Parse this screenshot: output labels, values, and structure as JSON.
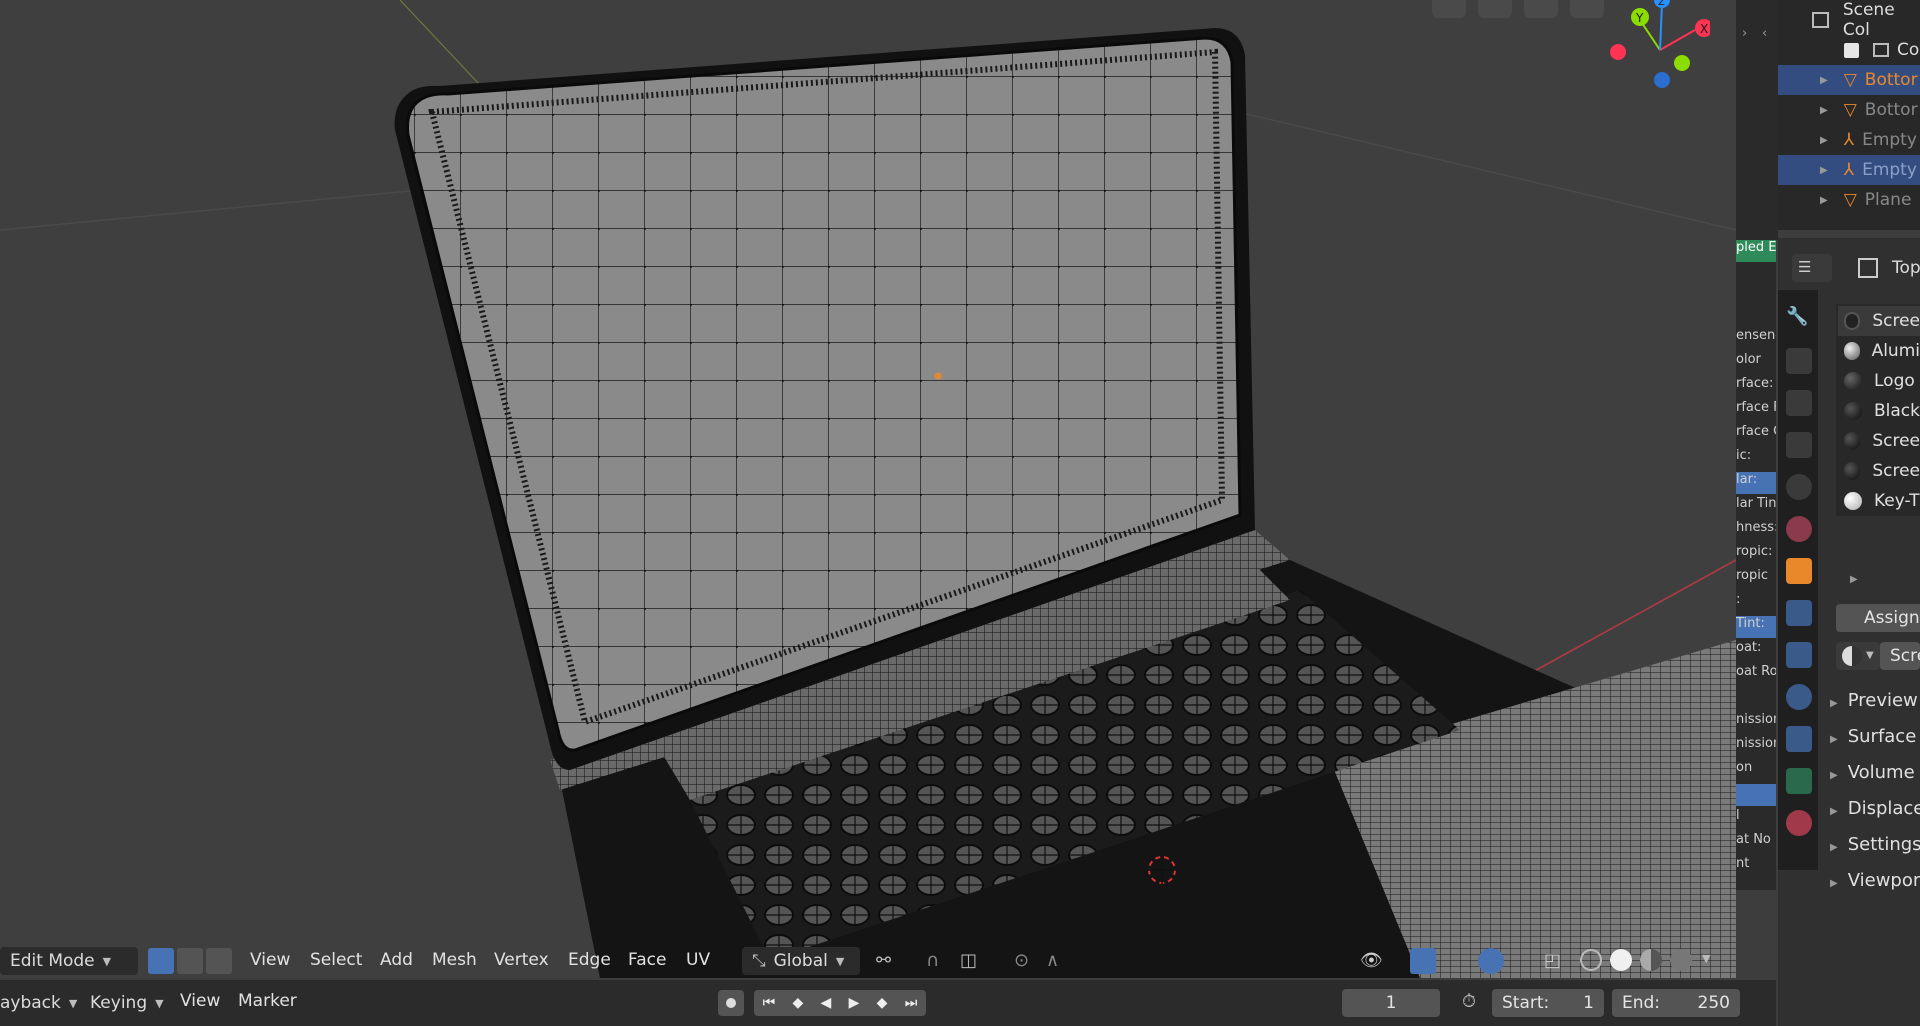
{
  "viewport_header": {
    "mode_label": "Edit Mode",
    "menus": [
      "View",
      "Select",
      "Add",
      "Mesh",
      "Vertex",
      "Edge",
      "Face",
      "UV"
    ],
    "transform_orientation": "Global"
  },
  "timeline": {
    "menus": [
      "ayback",
      "Keying",
      "View",
      "Marker"
    ],
    "current_frame": "1",
    "start_label": "Start:",
    "start_value": "1",
    "end_label": "End:",
    "end_value": "250"
  },
  "gizmo": {
    "y": "Y",
    "x": "X",
    "z": "Z"
  },
  "outliner": {
    "root": "Scene Col",
    "items": [
      {
        "label": "Co"
      },
      {
        "label": "Bottor"
      },
      {
        "label": "Bottor"
      },
      {
        "label": "Empty"
      },
      {
        "label": "Empty"
      },
      {
        "label": "Plane"
      }
    ]
  },
  "node_panel": {
    "badge": "pled E",
    "rows": [
      "ensen-",
      "olor",
      "rface:",
      "rface F",
      "rface C",
      "ic:",
      "lar:",
      "lar Tin",
      "hness:",
      "ropic:",
      "ropic",
      ":",
      "Tint:",
      "oat:",
      "oat Ro",
      "",
      "nission",
      "nission",
      "on",
      "",
      "l",
      "at No",
      "nt"
    ]
  },
  "properties": {
    "header_label": "Top",
    "materials": [
      "Scree",
      "Alumi",
      "Logo",
      "Black",
      "Scree",
      "Scree",
      "Key-T"
    ],
    "assign_button": "Assign",
    "material_name": "Scre",
    "sections": [
      "Preview",
      "Surface",
      "Volume",
      "Displace",
      "Settings",
      "Viewpor"
    ]
  },
  "colors": {
    "accent": "#4772b3",
    "selection_orange": "#e8882a",
    "x_axis": "#ff3352",
    "y_axis": "#8bdc00",
    "z_axis": "#2890ff"
  }
}
